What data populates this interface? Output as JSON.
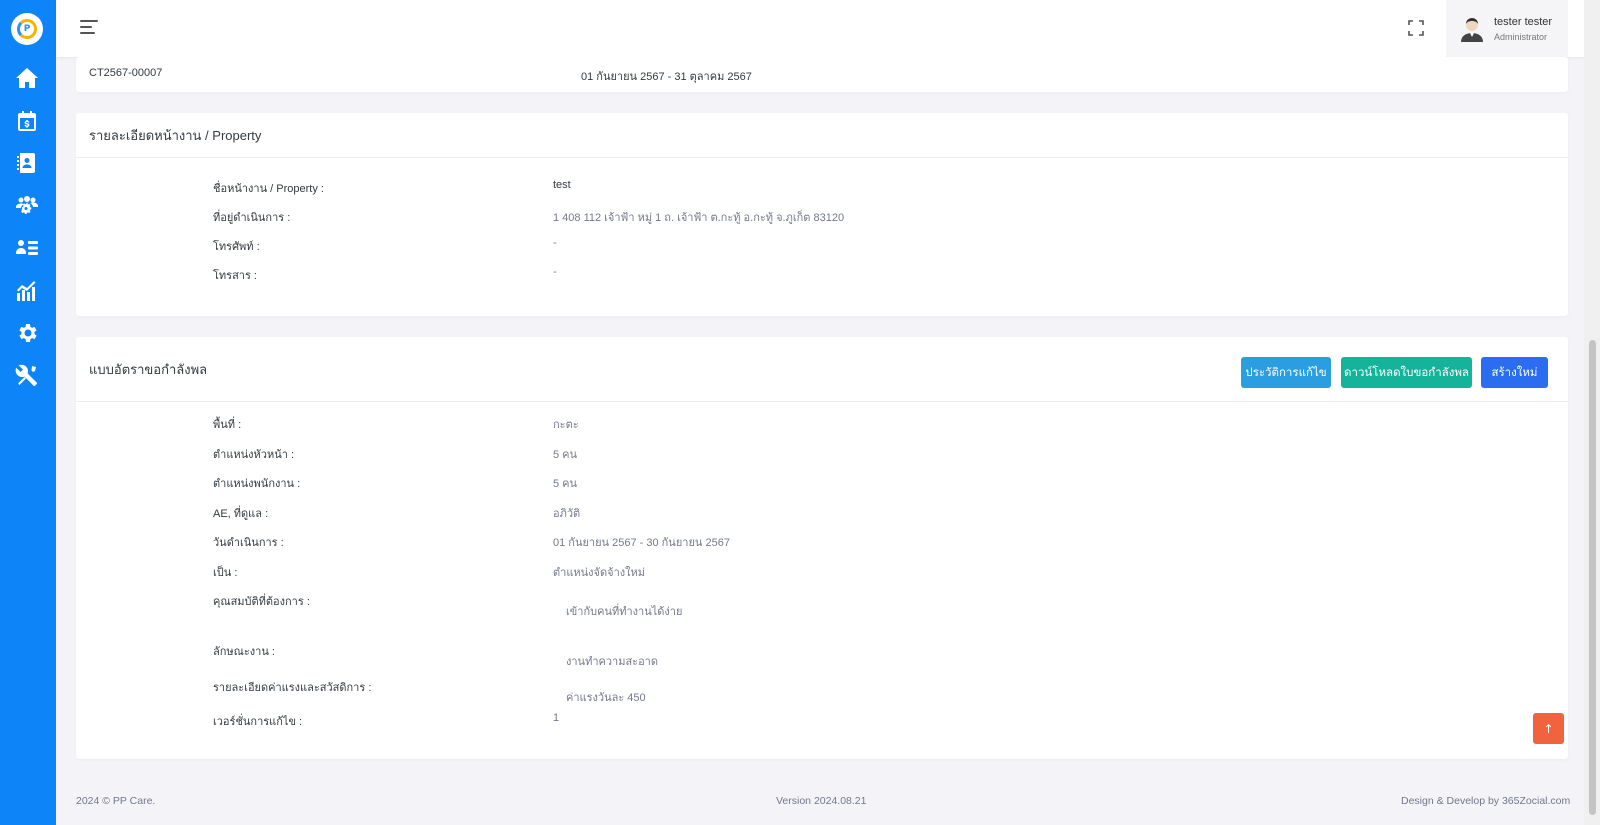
{
  "header": {
    "user_name": "tester tester",
    "user_role": "Administrator"
  },
  "contract": {
    "code": "CT2567-00007",
    "period": "01 กันยายน 2567 - 31 ตุลาคม 2567"
  },
  "property": {
    "title": "รายละเอียดหน้างาน / Property",
    "rows": [
      {
        "label": "ชื่อหน้างาน / Property :",
        "value": "test"
      },
      {
        "label": "ที่อยู่ดำเนินการ :",
        "value": "1 408 112 เจ้าฟ้า หมู่ 1 ถ. เจ้าฟ้า ต.กะทู้ อ.กะทู้ จ.ภูเก็ต 83120"
      },
      {
        "label": "โทรศัพท์ :",
        "value": "-"
      },
      {
        "label": "โทรสาร :",
        "value": "-"
      }
    ]
  },
  "request": {
    "title": "แบบอัตราขอกำลังพล",
    "buttons": {
      "history": "ประวัติการแก้ไข",
      "download": "ดาวน์โหลดใบขอกำลังพล",
      "create": "สร้างใหม่"
    },
    "rows": [
      {
        "label": "พื้นที่ :",
        "value": "กะตะ"
      },
      {
        "label": "ตำแหน่งหัวหน้า :",
        "value": "5 คน"
      },
      {
        "label": "ตำแหน่งพนักงาน :",
        "value": "5 คน"
      },
      {
        "label": "AE, ที่ดูแล :",
        "value": "อภิวัติ"
      },
      {
        "label": "วันดำเนินการ :",
        "value": "01 กันยายน 2567 - 30 กันยายน 2567"
      },
      {
        "label": "เป็น :",
        "value": "ตำแหน่งจัดจ้างใหม่"
      },
      {
        "label": "คุณสมบัติที่ต้องการ :",
        "value": "เข้ากับคนที่ทำงานได้ง่าย"
      },
      {
        "label": "ลักษณะงาน :",
        "value": "งานทำความสะอาด"
      },
      {
        "label": "รายละเอียดค่าแรงและสวัสดิการ :",
        "value": "ค่าแรงวันละ 450"
      },
      {
        "label": "เวอร์ชั่นการแก้ไข :",
        "value": "1"
      }
    ]
  },
  "footer": {
    "copyright": "2024 © PP Care.",
    "version": "Version 2024.08.21",
    "credit": "Design & Develop by 365Zocial.com"
  }
}
